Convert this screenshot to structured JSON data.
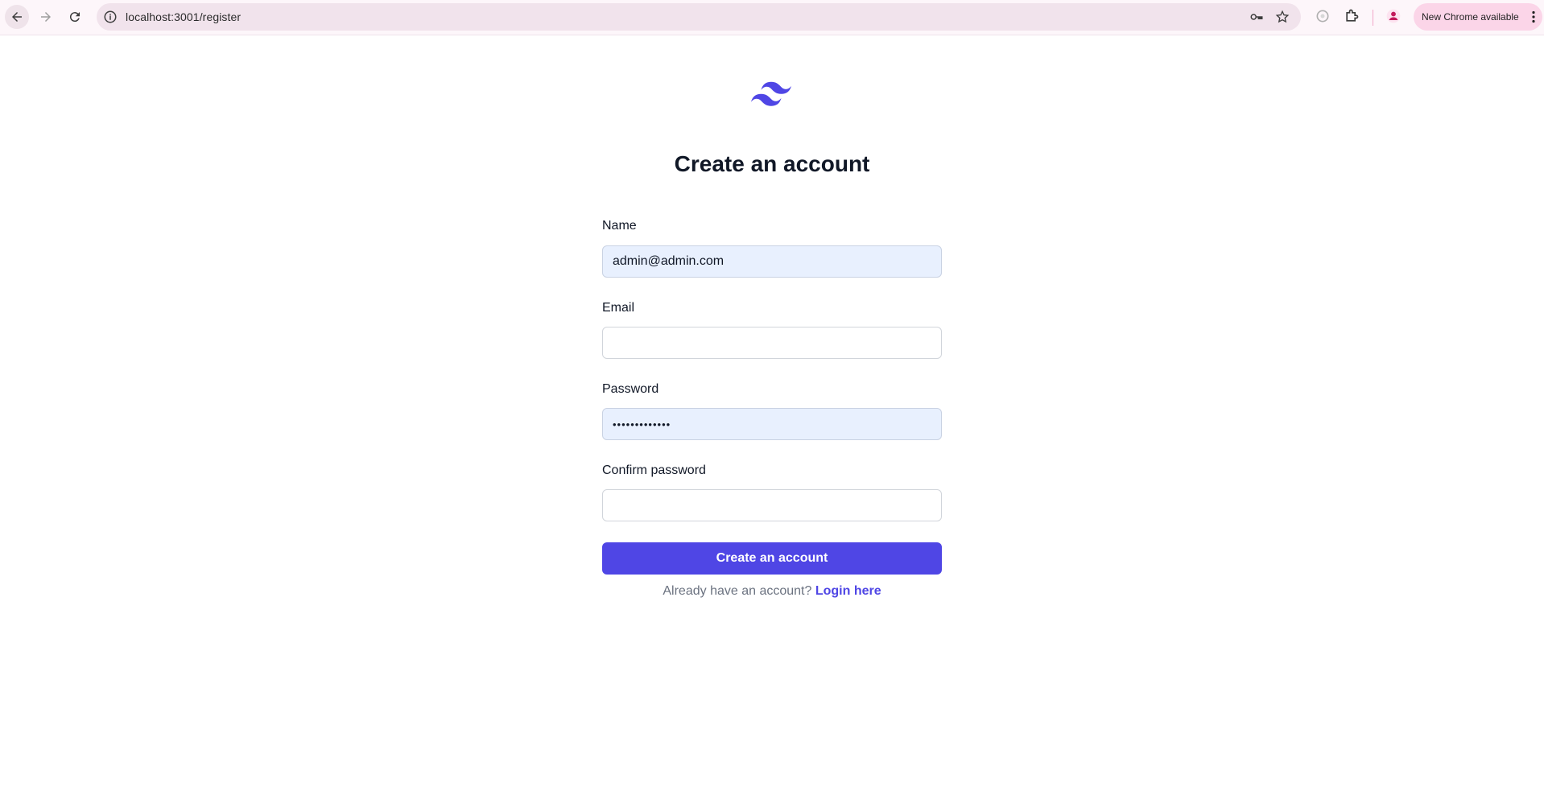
{
  "browser": {
    "url": "localhost:3001/register",
    "update_label": "New Chrome available",
    "icons": [
      "back-arrow-icon",
      "forward-arrow-icon",
      "reload-icon",
      "site-info-icon",
      "password-key-icon",
      "bookmark-star-icon",
      "media-icon",
      "extensions-puzzle-icon",
      "profile-avatar-icon",
      "more-menu-icon"
    ]
  },
  "page": {
    "logo": "tailwind-logo-icon",
    "title": "Create an account",
    "accent_color": "#4f46e5",
    "form": {
      "name_label": "Name",
      "name_value": "admin@admin.com",
      "email_label": "Email",
      "email_value": "",
      "password_label": "Password",
      "password_value": "•••••••••••••",
      "confirm_label": "Confirm password",
      "confirm_value": "",
      "submit_label": "Create an account"
    },
    "signin": {
      "prompt": "Already have an account?",
      "link": "Login here"
    }
  }
}
